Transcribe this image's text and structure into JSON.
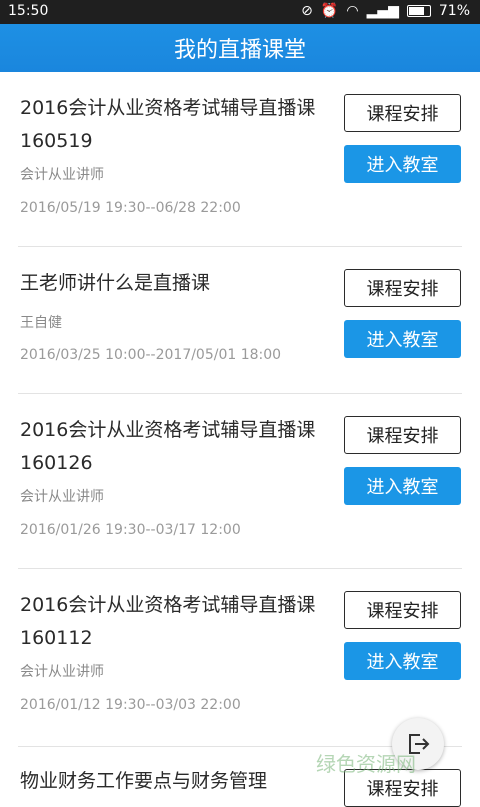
{
  "status": {
    "time": "15:50",
    "battery": "71%"
  },
  "header": {
    "title": "我的直播课堂"
  },
  "items": [
    {
      "title": "2016会计从业资格考试辅导直播课160519",
      "teacher": "会计从业讲师",
      "time": "2016/05/19 19:30--06/28 22:00",
      "schedule_label": "课程安排",
      "enter_label": "进入教室"
    },
    {
      "title": "王老师讲什么是直播课",
      "teacher": "王自健",
      "time": "2016/03/25 10:00--2017/05/01 18:00",
      "schedule_label": "课程安排",
      "enter_label": "进入教室"
    },
    {
      "title": "2016会计从业资格考试辅导直播课160126",
      "teacher": "会计从业讲师",
      "time": "2016/01/26 19:30--03/17 12:00",
      "schedule_label": "课程安排",
      "enter_label": "进入教室"
    },
    {
      "title": "2016会计从业资格考试辅导直播课160112",
      "teacher": "会计从业讲师",
      "time": "2016/01/12 19:30--03/03 22:00",
      "schedule_label": "课程安排",
      "enter_label": "进入教室"
    },
    {
      "title": "物业财务工作要点与财务管理",
      "teacher": "",
      "time": "",
      "schedule_label": "课程安排",
      "enter_label": ""
    }
  ],
  "watermark": "绿色资源网"
}
